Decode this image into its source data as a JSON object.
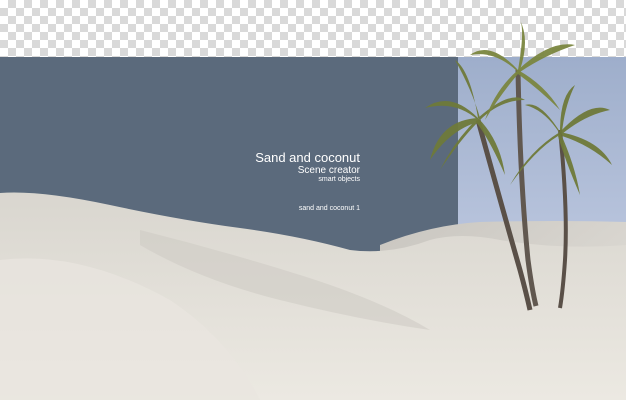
{
  "title": "Sand and coconut",
  "subtitle": "Scene creator",
  "tagline": "smart objects",
  "caption": "sand and coconut 1",
  "colors": {
    "backdrop": "#5b6a7c",
    "sky": "#b7c3dc",
    "sand": "#e4e1da",
    "palm_leaf": "#6f7a3a",
    "palm_trunk": "#5a5048"
  },
  "icons": [
    "palm-tree-icon"
  ]
}
